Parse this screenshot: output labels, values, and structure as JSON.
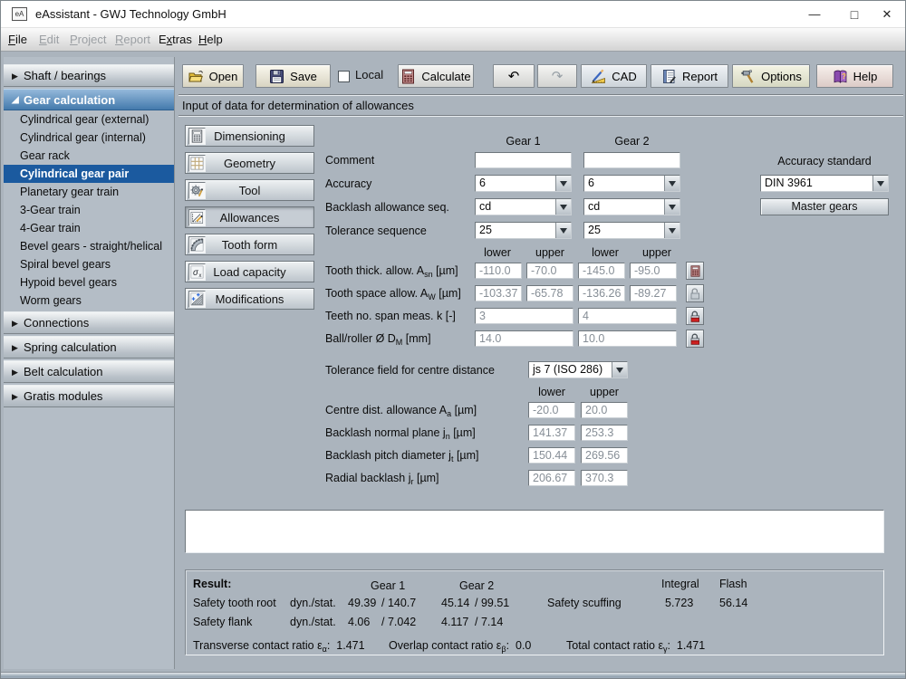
{
  "window": {
    "title": "eAssistant - GWJ Technology GmbH",
    "icon_text": "eA"
  },
  "icons": {
    "minimize": "—",
    "maximize": "□",
    "close": "✕",
    "undo": "↶",
    "redo": "↷",
    "collapsed_arrow": "▶",
    "expanded_arrow": "◢"
  },
  "menubar": {
    "items": [
      {
        "label": "File",
        "mnemonic": 0,
        "enabled": true
      },
      {
        "label": "Edit",
        "mnemonic": 0,
        "enabled": false
      },
      {
        "label": "Project",
        "mnemonic": 0,
        "enabled": false
      },
      {
        "label": "Report",
        "mnemonic": 0,
        "enabled": false
      },
      {
        "label": "Extras",
        "mnemonic": 1,
        "enabled": true
      },
      {
        "label": "Help",
        "mnemonic": 0,
        "enabled": true
      }
    ]
  },
  "toolbar": {
    "open": "Open",
    "save": "Save",
    "local": "Local",
    "calculate": "Calculate",
    "cad": "CAD",
    "report": "Report",
    "options": "Options",
    "help": "Help"
  },
  "status_text": "Input of data for determination of allowances",
  "sidebar": {
    "sections": [
      {
        "label": "Shaft / bearings",
        "expanded": false
      },
      {
        "label": "Gear calculation",
        "expanded": true,
        "selected_item": "Cylindrical gear pair",
        "items": [
          "Cylindrical gear (external)",
          "Cylindrical gear (internal)",
          "Gear rack",
          "Cylindrical gear pair",
          "Planetary gear train",
          "3-Gear train",
          "4-Gear train",
          "Bevel gears - straight/helical",
          "Spiral bevel gears",
          "Hypoid bevel gears",
          "Worm gears"
        ]
      },
      {
        "label": "Connections",
        "expanded": false
      },
      {
        "label": "Spring calculation",
        "expanded": false
      },
      {
        "label": "Belt calculation",
        "expanded": false
      },
      {
        "label": "Gratis modules",
        "expanded": false
      }
    ]
  },
  "modules": [
    "Dimensioning",
    "Geometry",
    "Tool",
    "Allowances",
    "Tooth form",
    "Load capacity",
    "Modifications"
  ],
  "form": {
    "gear1_header": "Gear 1",
    "gear2_header": "Gear 2",
    "comment_label": "Comment",
    "comment_gear1": "",
    "comment_gear2": "",
    "accuracy_label": "Accuracy",
    "accuracy_gear1": "6",
    "accuracy_gear2": "6",
    "backlash_seq_label": "Backlash allowance seq.",
    "backlash_seq_gear1": "cd",
    "backlash_seq_gear2": "cd",
    "tolerance_seq_label": "Tolerance sequence",
    "tolerance_seq_gear1": "25",
    "tolerance_seq_gear2": "25",
    "accuracy_standard_label": "Accuracy standard",
    "accuracy_standard_value": "DIN 3961",
    "master_gears_button": "Master gears",
    "col_lower": "lower",
    "col_upper": "upper",
    "allowance_rows": [
      {
        "label_pre": "Tooth thick. allow. A",
        "label_sub": "sn",
        "label_post": " [µm]",
        "g1_lower": "-110.0",
        "g1_upper": "-70.0",
        "g2_lower": "-145.0",
        "g2_upper": "-95.0"
      },
      {
        "label_pre": "Tooth space allow. A",
        "label_sub": "W",
        "label_post": " [µm]",
        "g1_lower": "-103.37",
        "g1_upper": "-65.78",
        "g2_lower": "-136.26",
        "g2_upper": "-89.27"
      },
      {
        "label_pre": "Teeth no. span meas. k [-]",
        "label_sub": "",
        "label_post": "",
        "g1": "3",
        "g2": "4"
      },
      {
        "label_pre": "Ball/roller Ø D",
        "label_sub": "M",
        "label_post": " [mm]",
        "g1": "14.0",
        "g2": "10.0"
      }
    ],
    "centre_tol_label": "Tolerance field for centre distance",
    "centre_tol_value": "js 7 (ISO 286)",
    "centre_rows": [
      {
        "label_pre": "Centre dist. allowance A",
        "label_sub": "a",
        "label_post": " [µm]",
        "lower": "-20.0",
        "upper": "20.0"
      },
      {
        "label_pre": "Backlash normal plane j",
        "label_sub": "n",
        "label_post": " [µm]",
        "lower": "141.37",
        "upper": "253.3"
      },
      {
        "label_pre": "Backlash pitch diameter j",
        "label_sub": "t",
        "label_post": " [µm]",
        "lower": "150.44",
        "upper": "269.56"
      },
      {
        "label_pre": "Radial backlash j",
        "label_sub": "r",
        "label_post": " [µm]",
        "lower": "206.67",
        "upper": "370.3"
      }
    ]
  },
  "result": {
    "title": "Result:",
    "gear1_header": "Gear 1",
    "gear2_header": "Gear 2",
    "integral_header": "Integral",
    "flash_header": "Flash",
    "rows": [
      {
        "label": "Safety tooth root",
        "mode": "dyn./stat.",
        "g1_dyn": "49.39",
        "g1_stat": "/ 140.7",
        "g2_dyn": "45.14",
        "g2_stat": "/ 99.51"
      },
      {
        "label": "Safety flank",
        "mode": "dyn./stat.",
        "g1_dyn": "4.06",
        "g1_stat": "/ 7.042",
        "g2_dyn": "4.117",
        "g2_stat": "/ 7.14"
      }
    ],
    "scuffing": {
      "label": "Safety scuffing",
      "integral": "5.723",
      "flash": "56.14"
    },
    "ratios": [
      {
        "pre": "Transverse contact ratio ε",
        "sub": "α",
        "post": ":  1.471"
      },
      {
        "pre": "Overlap contact ratio ε",
        "sub": "β",
        "post": ":  0.0"
      },
      {
        "pre": "Total contact ratio ε",
        "sub": "γ",
        "post": ":  1.471"
      }
    ]
  }
}
